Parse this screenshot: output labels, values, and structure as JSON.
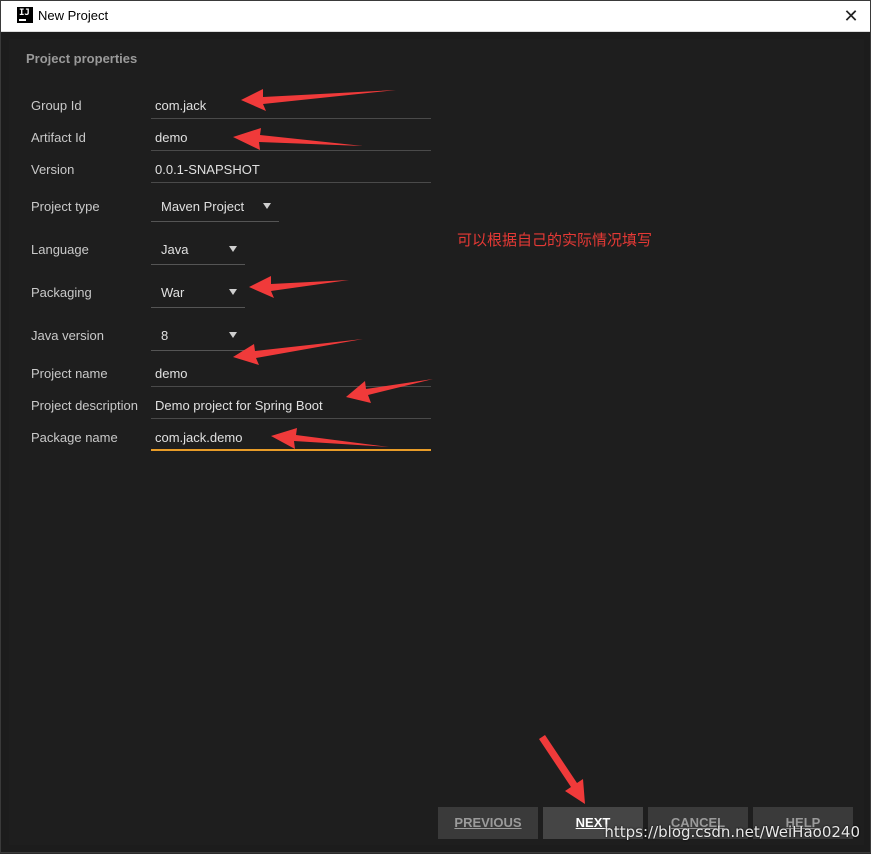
{
  "window": {
    "title": "New Project",
    "close_glyph": "✕",
    "app_icon_text": "IJ"
  },
  "section": {
    "title": "Project properties"
  },
  "fields": {
    "group_id": {
      "label": "Group Id",
      "value": "com.jack"
    },
    "artifact_id": {
      "label": "Artifact Id",
      "value": "demo"
    },
    "version": {
      "label": "Version",
      "value": "0.0.1-SNAPSHOT"
    },
    "project_type": {
      "label": "Project type",
      "value": "Maven Project"
    },
    "language": {
      "label": "Language",
      "value": "Java"
    },
    "packaging": {
      "label": "Packaging",
      "value": "War"
    },
    "java_version": {
      "label": "Java version",
      "value": "8"
    },
    "project_name": {
      "label": "Project name",
      "value": "demo"
    },
    "project_description": {
      "label": "Project description",
      "value": "Demo project for Spring Boot"
    },
    "package_name": {
      "label": "Package name",
      "value": "com.jack.demo"
    }
  },
  "annotation": {
    "note": "可以根据自己的实际情况填写",
    "arrow_color": "#f03a3a"
  },
  "buttons": {
    "previous": "PREVIOUS",
    "next": "NEXT",
    "cancel": "CANCEL",
    "help": "HELP"
  },
  "watermark": "https://blog.csdn.net/WeiHao0240",
  "colors": {
    "background": "#1e1e1e",
    "focus_underline": "#e89c28",
    "annotation_red": "#e53935"
  }
}
